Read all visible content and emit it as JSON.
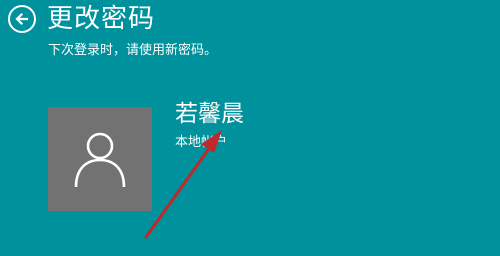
{
  "header": {
    "back_icon": "back-arrow-circle-icon",
    "title": "更改密码",
    "subtitle": "下次登录时，请使用新密码。"
  },
  "account": {
    "avatar_icon": "user-silhouette-icon",
    "name": "若馨晨",
    "type": "本地帐户"
  },
  "annotation": {
    "icon": "red-pointer-arrow-icon",
    "color": "#c0282a"
  },
  "colors": {
    "background": "#00929c",
    "avatar_background": "#727272",
    "text": "#ffffff"
  }
}
